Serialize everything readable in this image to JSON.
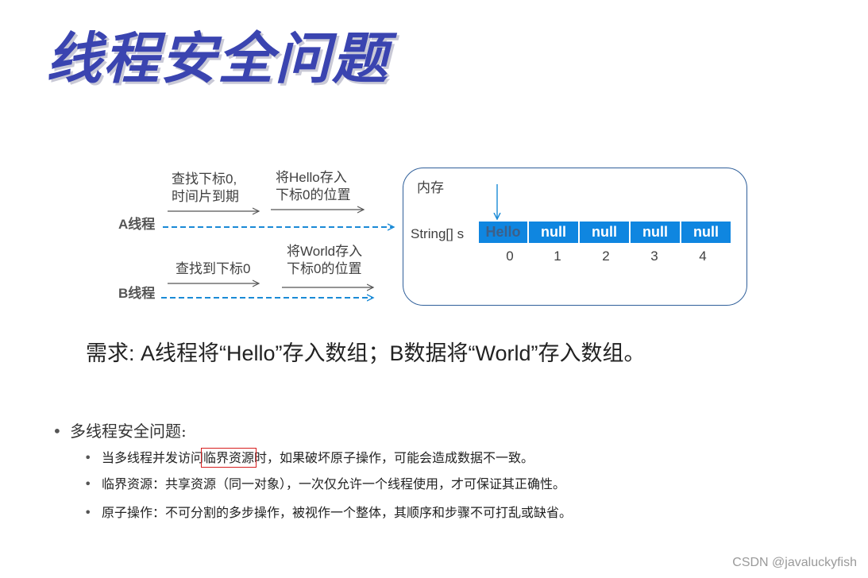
{
  "slide": {
    "title": "线程安全问题",
    "watermark": "CSDN @javaluckyfish"
  },
  "diagram": {
    "thread_a": {
      "label": "A线程",
      "step1_line1": "查找下标0,",
      "step1_line2": "时间片到期",
      "step2_line1": "将Hello存入",
      "step2_line2": "下标0的位置"
    },
    "thread_b": {
      "label": "B线程",
      "step1": "查找到下标0",
      "step2_line1": "将World存入",
      "step2_line2": "下标0的位置"
    },
    "memory": {
      "title": "内存",
      "array_label": "String[] s",
      "cells": [
        "Hello",
        "null",
        "null",
        "null",
        "null"
      ],
      "indices": [
        "0",
        "1",
        "2",
        "3",
        "4"
      ],
      "cell_color": "#0f86e0",
      "box_border_color": "#2f5f9a"
    }
  },
  "requirement": "需求: A线程将“Hello”存入数组；B数据将“World”存入数组。",
  "bullets": {
    "main": "多线程安全问题:",
    "items": [
      {
        "before": "当多线程并发访问",
        "highlight": "临界资源",
        "after": "时，如果破坏原子操作，可能会造成数据不一致。"
      },
      {
        "text": "临界资源：共享资源（同一对象），一次仅允许一个线程使用，才可保证其正确性。"
      },
      {
        "text": "原子操作：不可分割的多步操作，被视作一个整体，其顺序和步骤不可打乱或缺省。"
      }
    ],
    "bullet_char": "•"
  },
  "colors": {
    "title": "#3a44b0",
    "arrow_dark": "#555555",
    "arrow_blue": "#1a8ad6",
    "highlight_box": "#d81e1e"
  }
}
